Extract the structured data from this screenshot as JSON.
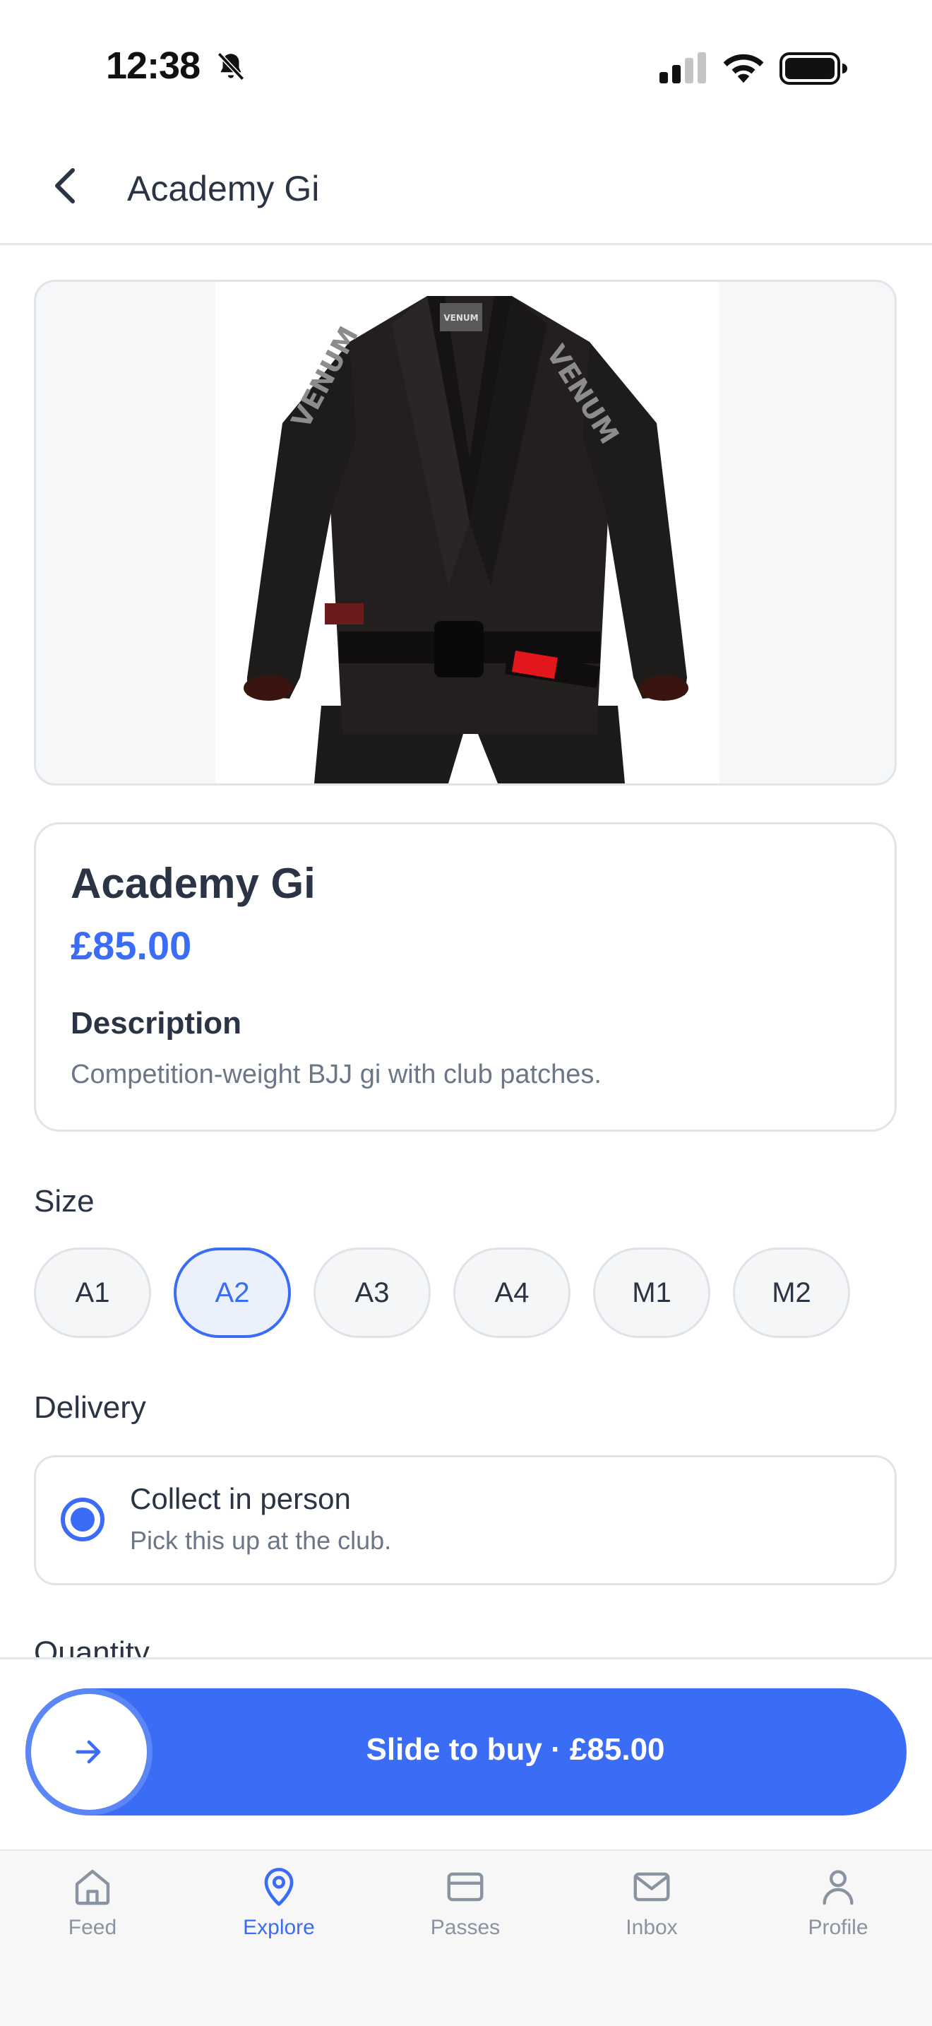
{
  "status_bar": {
    "time": "12:38"
  },
  "header": {
    "title": "Academy Gi"
  },
  "product": {
    "name": "Academy Gi",
    "price": "£85.00",
    "description_heading": "Description",
    "description": "Competition-weight BJJ gi with club patches.",
    "image_brand_text": "VENUM"
  },
  "size": {
    "label": "Size",
    "options": [
      "A1",
      "A2",
      "A3",
      "A4",
      "M1",
      "M2"
    ],
    "selected": "A2"
  },
  "delivery": {
    "label": "Delivery",
    "option_title": "Collect in person",
    "option_subtitle": "Pick this up at the club."
  },
  "quantity": {
    "label": "Quantity"
  },
  "purchase": {
    "slide_label": "Slide to buy · £85.00"
  },
  "tab_bar": {
    "tabs": [
      {
        "label": "Feed",
        "icon": "home-icon"
      },
      {
        "label": "Explore",
        "icon": "location-pin-icon"
      },
      {
        "label": "Passes",
        "icon": "card-icon"
      },
      {
        "label": "Inbox",
        "icon": "mail-icon"
      },
      {
        "label": "Profile",
        "icon": "person-icon"
      }
    ],
    "active": "Explore"
  },
  "colors": {
    "accent": "#3b6cf5",
    "text": "#2b3445",
    "muted": "#6b7789"
  }
}
